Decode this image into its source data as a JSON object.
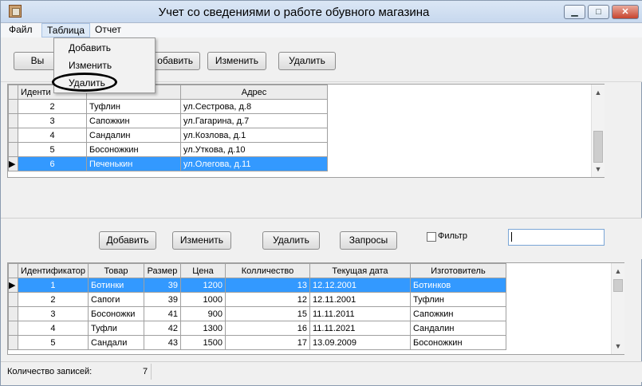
{
  "window": {
    "title": "Учет со сведениями о работе обувного магазина",
    "controls": {
      "minimize": "▁",
      "maximize": "□",
      "close": "✕"
    }
  },
  "menubar": {
    "items": [
      {
        "label": "Файл"
      },
      {
        "label": "Таблица"
      },
      {
        "label": "Отчет"
      }
    ]
  },
  "dropdown": {
    "items": [
      {
        "label": "Добавить"
      },
      {
        "label": "Изменить"
      },
      {
        "label": "Удалить"
      }
    ]
  },
  "top_toolbar": {
    "partial_button": "Вы",
    "add_partial": "обавить",
    "edit": "Изменить",
    "delete": "Удалить"
  },
  "grid1": {
    "headers": [
      "Иденти",
      "Адрес"
    ],
    "rows": [
      {
        "id": "2",
        "name": "Туфлин",
        "address": "ул.Сестрова, д.8"
      },
      {
        "id": "3",
        "name": "Сапожкин",
        "address": "ул.Гагарина, д.7"
      },
      {
        "id": "4",
        "name": "Сандалин",
        "address": "ул.Козлова, д.1"
      },
      {
        "id": "5",
        "name": "Босоножкин",
        "address": "ул.Уткова, д.10"
      },
      {
        "id": "6",
        "name": "Печенькин",
        "address": "ул.Олегова, д.11"
      }
    ],
    "selected_index": 4
  },
  "mid_toolbar": {
    "add": "Добавить",
    "edit": "Изменить",
    "delete": "Удалить",
    "queries": "Запросы",
    "filter_label": "Фильтр",
    "filter_value": ""
  },
  "grid2": {
    "headers": [
      "Идентификатор",
      "Товар",
      "Размер",
      "Цена",
      "Колличество",
      "Текущая дата",
      "Изготовитель"
    ],
    "rows": [
      {
        "id": "1",
        "product": "Ботинки",
        "size": "39",
        "price": "1200",
        "qty": "13",
        "date": "12.12.2001",
        "maker": "Ботинков"
      },
      {
        "id": "2",
        "product": "Сапоги",
        "size": "39",
        "price": "1000",
        "qty": "12",
        "date": "12.11.2001",
        "maker": "Туфлин"
      },
      {
        "id": "3",
        "product": "Босоножки",
        "size": "41",
        "price": "900",
        "qty": "15",
        "date": "11.11.2011",
        "maker": "Сапожкин"
      },
      {
        "id": "4",
        "product": "Туфли",
        "size": "42",
        "price": "1300",
        "qty": "16",
        "date": "11.11.2021",
        "maker": "Сандалин"
      },
      {
        "id": "5",
        "product": "Сандали",
        "size": "43",
        "price": "1500",
        "qty": "17",
        "date": "13.09.2009",
        "maker": "Босоножкин"
      }
    ],
    "selected_index": 0
  },
  "status": {
    "label": "Количество записей:",
    "count": "7"
  }
}
